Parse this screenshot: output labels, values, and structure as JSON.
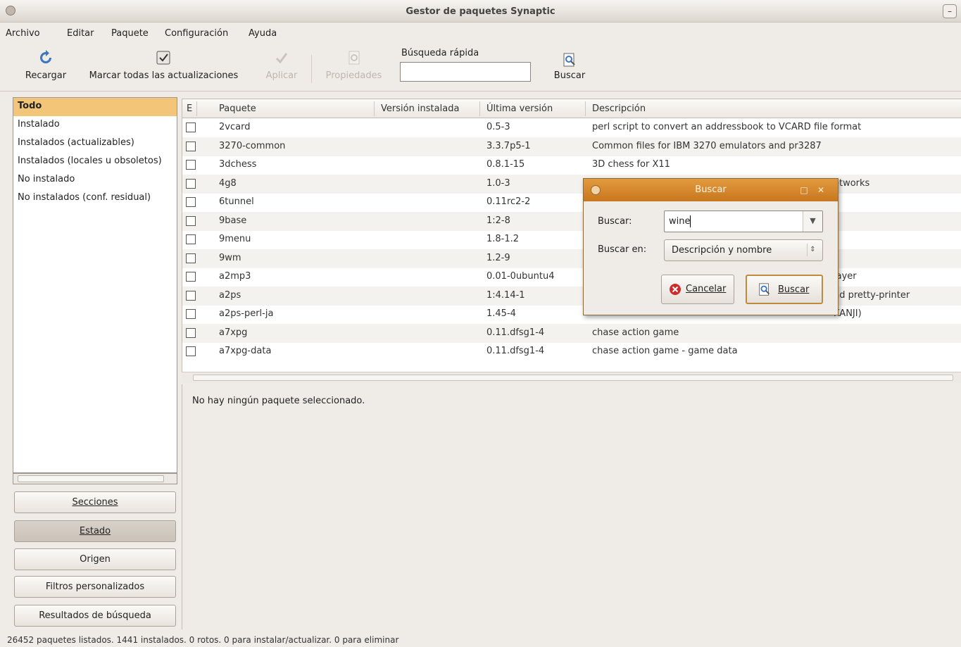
{
  "window": {
    "title": "Gestor de paquetes Synaptic",
    "control": "–"
  },
  "menu": [
    "Archivo",
    "Editar",
    "Paquete",
    "Configuración",
    "Ayuda"
  ],
  "toolbar": {
    "reload": "Recargar",
    "mark_all": "Marcar todas las actualizaciones",
    "apply": "Aplicar",
    "properties": "Propiedades",
    "quick_search_label": "Búsqueda rápida",
    "quick_search_value": "",
    "search": "Buscar"
  },
  "sidebar": {
    "items": [
      "Todo",
      "Instalado",
      "Instalados (actualizables)",
      "Instalados (locales u obsoletos)",
      "No instalado",
      "No instalados (conf. residual)"
    ],
    "selected_index": 0
  },
  "side_buttons": [
    "Secciones",
    "Estado",
    "Origen",
    "Filtros personalizados",
    "Resultados de búsqueda"
  ],
  "table": {
    "columns": [
      "E",
      "Paquete",
      "Versión instalada",
      "Última versión",
      "Descripción"
    ],
    "rows": [
      {
        "package": "2vcard",
        "installed": "",
        "latest": "0.5-3",
        "description": "perl script to convert an addressbook to VCARD file format"
      },
      {
        "package": "3270-common",
        "installed": "",
        "latest": "3.3.7p5-1",
        "description": "Common files for IBM 3270 emulators and pr3287"
      },
      {
        "package": "3dchess",
        "installed": "",
        "latest": "0.8.1-15",
        "description": "3D chess for X11"
      },
      {
        "package": "4g8",
        "installed": "",
        "latest": "1.0-3",
        "description": "etworks"
      },
      {
        "package": "6tunnel",
        "installed": "",
        "latest": "0.11rc2-2",
        "description": ""
      },
      {
        "package": "9base",
        "installed": "",
        "latest": "1:2-8",
        "description": ""
      },
      {
        "package": "9menu",
        "installed": "",
        "latest": "1.8-1.2",
        "description": ""
      },
      {
        "package": "9wm",
        "installed": "",
        "latest": "1.2-9",
        "description": ""
      },
      {
        "package": "a2mp3",
        "installed": "",
        "latest": "0.01-0ubuntu4",
        "description": "layer"
      },
      {
        "package": "a2ps",
        "installed": "",
        "latest": "1:4.14-1",
        "description": "nd pretty-printer"
      },
      {
        "package": "a2ps-perl-ja",
        "installed": "",
        "latest": "1.45-4",
        "description": "KANJI)"
      },
      {
        "package": "a7xpg",
        "installed": "",
        "latest": "0.11.dfsg1-4",
        "description": "chase action game"
      },
      {
        "package": "a7xpg-data",
        "installed": "",
        "latest": "0.11.dfsg1-4",
        "description": "chase action game - game data"
      }
    ]
  },
  "detail_text": "No hay ningún paquete seleccionado.",
  "status": "26452 paquetes listados. 1441 instalados. 0 rotos. 0 para instalar/actualizar. 0 para eliminar",
  "dialog": {
    "title": "Buscar",
    "search_label": "Buscar:",
    "search_value": "wine",
    "search_in_label": "Buscar en:",
    "search_in_value": "Descripción y nombre",
    "cancel": "Cancelar",
    "ok": "Buscar"
  }
}
